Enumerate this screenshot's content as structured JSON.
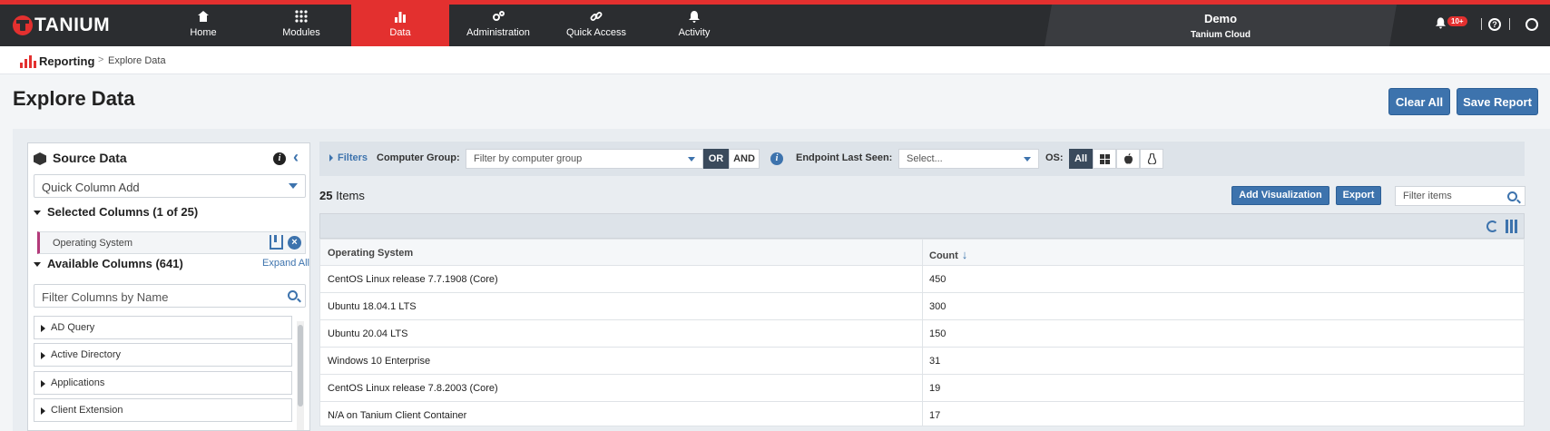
{
  "app": {
    "logo_text": "TANIUM"
  },
  "nav": {
    "items": [
      {
        "label": "Home",
        "icon": "home-icon"
      },
      {
        "label": "Modules",
        "icon": "grid-icon"
      },
      {
        "label": "Data",
        "icon": "bar-chart-icon"
      },
      {
        "label": "Administration",
        "icon": "gears-icon"
      },
      {
        "label": "Quick Access",
        "icon": "link-icon"
      },
      {
        "label": "Activity",
        "icon": "bell-icon"
      }
    ],
    "active": "Data",
    "demo_title": "Demo",
    "demo_subtitle": "Tanium Cloud",
    "notification_badge": "10+"
  },
  "breadcrumb": {
    "root": "Reporting",
    "separator": ">",
    "current": "Explore Data"
  },
  "page": {
    "title": "Explore Data",
    "clear_all": "Clear All",
    "save_report": "Save Report"
  },
  "source": {
    "title": "Source Data",
    "quick_add_placeholder": "Quick Column Add",
    "selected_header": "Selected Columns (1 of 25)",
    "selected_columns": [
      "Operating System"
    ],
    "available_header": "Available Columns (641)",
    "expand_all": "Expand All",
    "filter_placeholder": "Filter Columns by Name",
    "categories": [
      "AD Query",
      "Active Directory",
      "Applications",
      "Client Extension"
    ]
  },
  "filters": {
    "toggle": "Filters",
    "computer_group_label": "Computer Group:",
    "computer_group_placeholder": "Filter by computer group",
    "or": "OR",
    "and": "AND",
    "endpoint_label": "Endpoint Last Seen:",
    "endpoint_placeholder": "Select...",
    "os_label": "OS:",
    "os_all": "All"
  },
  "results": {
    "count": "25",
    "count_label": "Items",
    "add_visualization": "Add Visualization",
    "export": "Export",
    "filter_placeholder": "Filter items",
    "columns": [
      "Operating System",
      "Count"
    ],
    "rows": [
      [
        "CentOS Linux release 7.7.1908 (Core)",
        "450"
      ],
      [
        "Ubuntu 18.04.1 LTS",
        "300"
      ],
      [
        "Ubuntu 20.04 LTS",
        "150"
      ],
      [
        "Windows 10 Enterprise",
        "31"
      ],
      [
        "CentOS Linux release 7.8.2003 (Core)",
        "19"
      ],
      [
        "N/A on Tanium Client Container",
        "17"
      ]
    ]
  },
  "colors": {
    "brand_red": "#e3302f",
    "nav_bg": "#2b2d30",
    "accent_blue": "#3d73ad"
  }
}
